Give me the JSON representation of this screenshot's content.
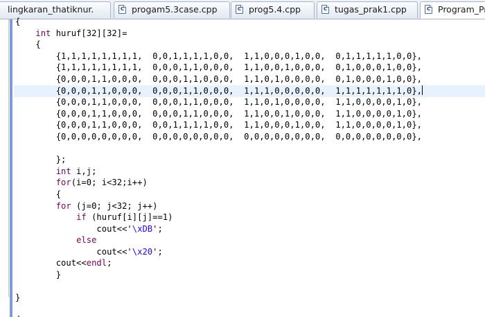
{
  "tabs": [
    {
      "label": "lingkaran_thatiknur.",
      "icon": "cpp-file-icon",
      "active": false
    },
    {
      "label": "progam5.3case.cpp",
      "icon": "cpp-file-icon",
      "active": false
    },
    {
      "label": "prog5.4.cpp",
      "icon": "cpp-file-icon",
      "active": false
    },
    {
      "label": "tugas_prak1.cpp",
      "icon": "cpp-file-icon",
      "active": false
    },
    {
      "label": "Program_Pr",
      "icon": "cpp-file-icon",
      "active": true
    }
  ],
  "cpp_icon_letter": "c",
  "editor": {
    "current_line_index": 6,
    "lines": [
      [
        {
          "t": "{"
        }
      ],
      [
        {
          "t": "    "
        },
        {
          "t": "int",
          "c": "kw"
        },
        {
          "t": " huruf[32][32]="
        }
      ],
      [
        {
          "t": "    {"
        }
      ],
      [
        {
          "t": "        {1,1,1,1,1,1,1,1,  0,0,1,1,1,1,0,0,  1,1,0,0,0,1,0,0,  0,1,1,1,1,1,0,0},"
        }
      ],
      [
        {
          "t": "        {1,1,1,1,1,1,1,1,  0,0,0,1,1,0,0,0,  1,1,0,0,1,0,0,0,  0,1,0,0,0,1,0,0},"
        }
      ],
      [
        {
          "t": "        {0,0,0,1,1,0,0,0,  0,0,0,1,1,0,0,0,  1,1,0,1,0,0,0,0,  0,1,0,0,0,1,0,0},"
        }
      ],
      [
        {
          "t": "        {0,0,0,1,1,0,0,0,  0,0,0,1,1,0,0,0,  1,1,1,0,0,0,0,0,  1,1,1,1,1,1,1,0},"
        }
      ],
      [
        {
          "t": "        {0,0,0,1,1,0,0,0,  0,0,0,1,1,0,0,0,  1,1,0,1,0,0,0,0,  1,1,0,0,0,0,1,0},"
        }
      ],
      [
        {
          "t": "        {0,0,0,1,1,0,0,0,  0,0,0,1,1,0,0,0,  1,1,0,0,1,0,0,0,  1,1,0,0,0,0,1,0},"
        }
      ],
      [
        {
          "t": "        {0,0,0,1,1,0,0,0,  0,0,1,1,1,1,0,0,  1,1,0,0,0,1,0,0,  1,1,0,0,0,0,1,0},"
        }
      ],
      [
        {
          "t": "        {0,0,0,0,0,0,0,0,  0,0,0,0,0,0,0,0,  0,0,0,0,0,0,0,0,  0,0,0,0,0,0,0,0},"
        }
      ],
      [
        {
          "t": ""
        }
      ],
      [
        {
          "t": "        };"
        }
      ],
      [
        {
          "t": "        "
        },
        {
          "t": "int",
          "c": "kw"
        },
        {
          "t": " i,j;"
        }
      ],
      [
        {
          "t": "        "
        },
        {
          "t": "for",
          "c": "kw"
        },
        {
          "t": "(i=0; i<32;i++)"
        }
      ],
      [
        {
          "t": "        {"
        }
      ],
      [
        {
          "t": "        "
        },
        {
          "t": "for",
          "c": "kw"
        },
        {
          "t": " (j=0; j<32; j++)"
        }
      ],
      [
        {
          "t": "            "
        },
        {
          "t": "if",
          "c": "kw"
        },
        {
          "t": " (huruf[i][j]==1)"
        }
      ],
      [
        {
          "t": "                cout<<'"
        },
        {
          "t": "\\xDB",
          "c": "str"
        },
        {
          "t": "';"
        }
      ],
      [
        {
          "t": "            "
        },
        {
          "t": "else",
          "c": "kw"
        }
      ],
      [
        {
          "t": "                cout<<'"
        },
        {
          "t": "\\x20",
          "c": "str"
        },
        {
          "t": "';"
        }
      ],
      [
        {
          "t": "        cout<<"
        },
        {
          "t": "endl",
          "c": "kw"
        },
        {
          "t": ";"
        }
      ],
      [
        {
          "t": "        }"
        }
      ],
      [
        {
          "t": ""
        }
      ],
      [
        {
          "t": "}"
        }
      ]
    ]
  }
}
